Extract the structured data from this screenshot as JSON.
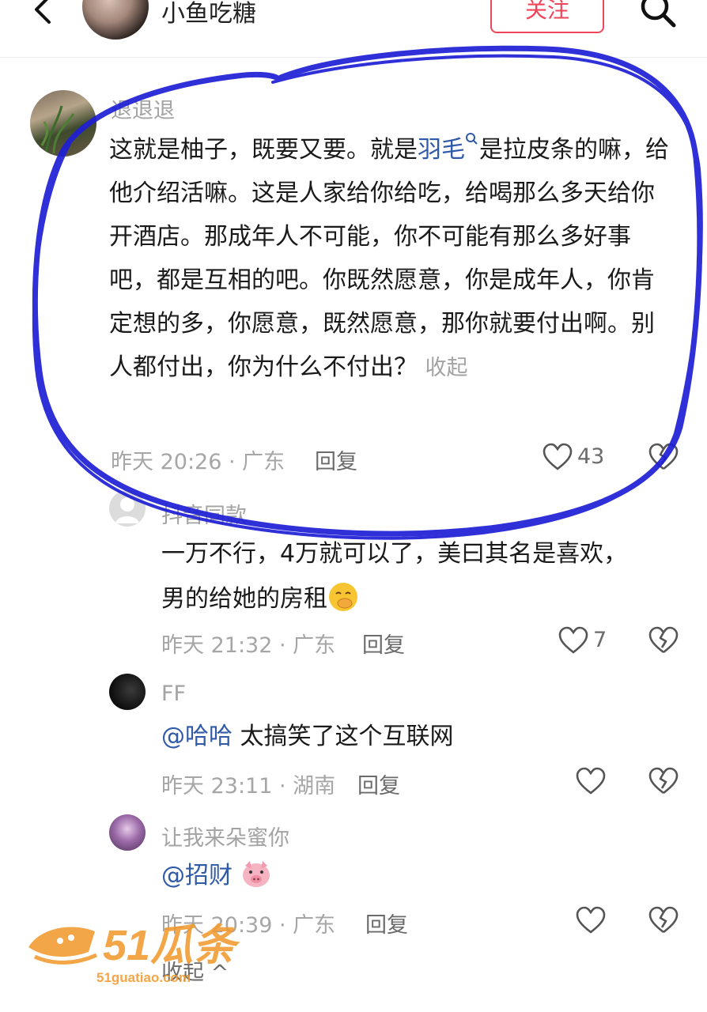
{
  "header": {
    "name": "小鱼吃糖",
    "follow_label": "关注"
  },
  "comments": [
    {
      "username": "退退退",
      "text_before": "这就是柚子，既要又要。就是",
      "link_word": "羽毛",
      "text_after": "是拉皮条的嘛，给他介绍活嘛。这是人家给你给吃，给喝那么多天给你开酒店。那成年人不可能，你不可能有那么多好事吧，都是互相的吧。你既然愿意，你是成年人，你肯定想的多，你愿意，既然愿意，那你就要付出啊。别人都付出，你为什么不付出？",
      "collapse": "收起",
      "time_loc": "昨天 20:26 · 广东",
      "reply": "回复",
      "likes": "43"
    },
    {
      "username": "抖音同款",
      "text": "一万不行，4万就可以了，美曰其名是喜欢，男的给她的房租",
      "time_loc": "昨天 21:32 · 广东",
      "reply": "回复",
      "likes": "7"
    },
    {
      "username": "FF",
      "mention": "@哈哈",
      "text": " 太搞笑了这个互联网",
      "time_loc": "昨天 23:11 · 湖南",
      "reply": "回复"
    },
    {
      "username": "让我来朵蜜你",
      "mention": "@招财",
      "time_loc": "昨天 20:39 · 广东",
      "reply": "回复"
    }
  ],
  "collapse_bottom": "收起 ^",
  "watermark": {
    "brand": "51瓜条",
    "url": "51guatiao.com"
  },
  "colors": {
    "accent": "#f0455a",
    "link": "#2f5aa8",
    "pen": "#1f1fd6",
    "watermark": "#f29a2e"
  }
}
